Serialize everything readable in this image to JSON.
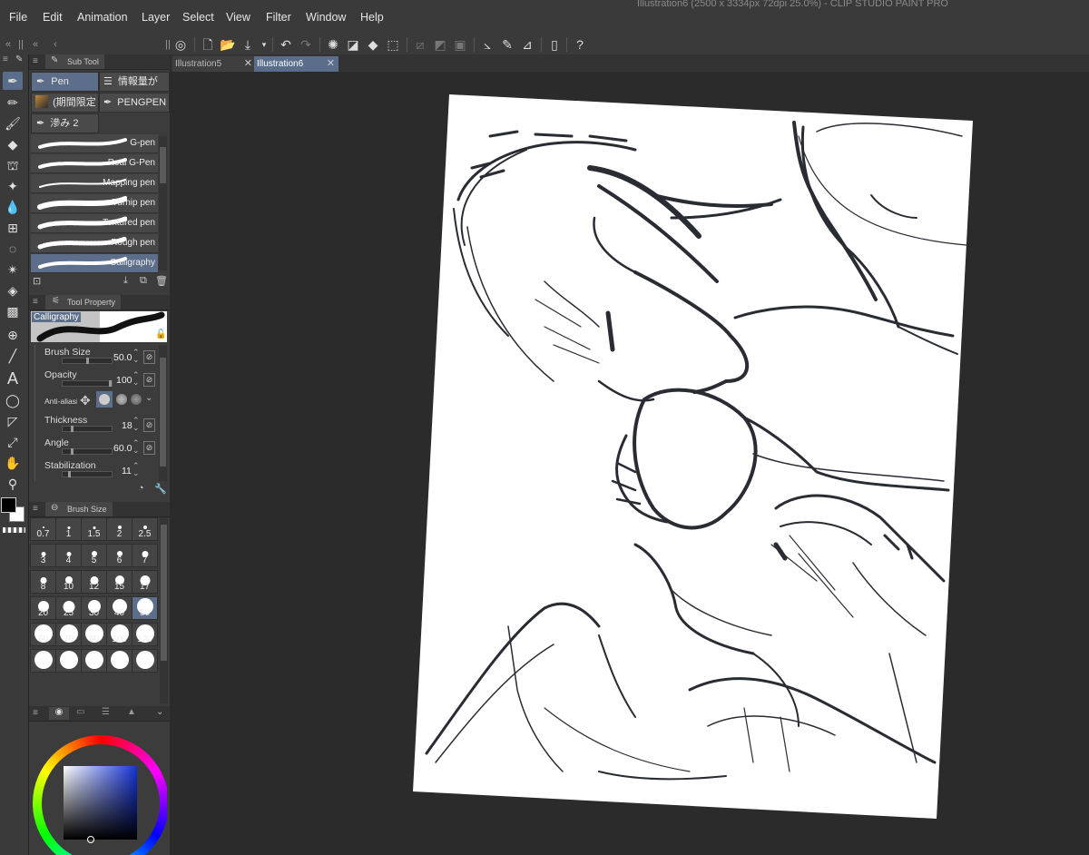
{
  "menubar": {
    "items": [
      "File",
      "Edit",
      "Animation",
      "Layer",
      "Select",
      "View",
      "Filter",
      "Window",
      "Help"
    ],
    "window_title": "Illustration6 (2500 x 3334px 72dpi 25.0%)  - CLIP STUDIO PAINT PRO"
  },
  "toolbar": {
    "tools": [
      "pen-icon",
      "pencil-icon",
      "brush-icon",
      "eraser-icon",
      "airbrush-icon",
      "decoration-icon",
      "blend-icon",
      "frame-icon",
      "lasso-icon",
      "auto-select-icon",
      "fill-icon",
      "gradient-icon",
      "operation-icon",
      "line-icon",
      "text-icon",
      "balloon-icon",
      "ruler-icon",
      "object-icon",
      "hand-icon",
      "eyedropper-icon"
    ],
    "text_tool_glyph": "A"
  },
  "subtool": {
    "title": "Sub Tool",
    "groups": [
      {
        "label": "Pen",
        "icon": "pen-icon"
      },
      {
        "label": "情報量が",
        "icon": "list-icon"
      },
      {
        "label": "(期間限定",
        "icon": "brush-set-icon"
      },
      {
        "label": "PENGPEN",
        "icon": "pen-icon"
      },
      {
        "label": "滲み 2",
        "icon": "pen-icon"
      }
    ],
    "brushes": [
      "G-pen",
      "Real G-Pen",
      "Mapping pen",
      "Turnip pen",
      "Textured pen",
      "Rough pen",
      "Calligraphy"
    ],
    "selected_brush": "Calligraphy"
  },
  "tool_property": {
    "title": "Tool Property",
    "preview_label": "Calligraphy",
    "props": [
      {
        "name": "Brush Size",
        "value": "50.0",
        "fraction": 0.5
      },
      {
        "name": "Opacity",
        "value": "100",
        "fraction": 1.0
      },
      {
        "name": "Anti-aliasing",
        "value": ""
      },
      {
        "name": "Thickness",
        "value": "18",
        "fraction": 0.18
      },
      {
        "name": "Angle",
        "value": "60.0",
        "fraction": 0.17
      },
      {
        "name": "Stabilization",
        "value": "11",
        "fraction": 0.11
      }
    ]
  },
  "brush_size": {
    "title": "Brush Size",
    "sizes": [
      "0.7",
      "1",
      "1.5",
      "2",
      "2.5",
      "3",
      "4",
      "5",
      "6",
      "7",
      "8",
      "10",
      "12",
      "15",
      "17",
      "20",
      "25",
      "30",
      "40",
      "50",
      "60",
      "70",
      "80",
      "100",
      "120"
    ],
    "selected": "50"
  },
  "document_tabs": [
    {
      "label": "Illustration5",
      "active": false
    },
    {
      "label": "Illustration6",
      "active": true
    }
  ],
  "colors": {
    "accent": "#5d6e8a",
    "main_color": "#000000",
    "sub_color": "#ffffff",
    "picker_hue": "#1533d8"
  }
}
